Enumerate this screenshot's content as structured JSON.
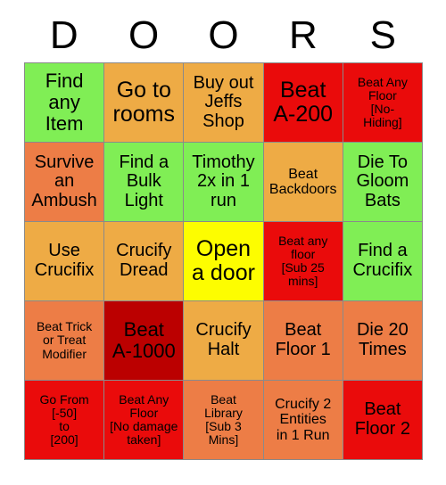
{
  "title": "DOORS Bingo Card",
  "header": {
    "letters": [
      "D",
      "O",
      "O",
      "R",
      "S"
    ]
  },
  "colors": {
    "green": "#80ee55",
    "golden": "#eeab45",
    "coral": "#ed7d46",
    "red": "#ea0b0b",
    "dark_red": "#bb0000",
    "yellow": "#fdfd00",
    "border": "#8a8a8a",
    "text": "#000000",
    "background": "#ffffff"
  },
  "grid": {
    "rows": 5,
    "columns": 5,
    "cells": [
      {
        "text": "Find\nany\nItem",
        "color": "#80ee55",
        "size": "fs-lg"
      },
      {
        "text": "Go to\nrooms",
        "color": "#eeab45",
        "size": "fs-xl"
      },
      {
        "text": "Buy out\nJeffs\nShop",
        "color": "#eeab45",
        "size": "fs-md"
      },
      {
        "text": "Beat\nA-200",
        "color": "#ea0b0b",
        "size": "fs-xl"
      },
      {
        "text": "Beat Any\nFloor\n[No-\nHiding]",
        "color": "#ea0b0b",
        "size": "fs-xs"
      },
      {
        "text": "Survive\nan\nAmbush",
        "color": "#ed7d46",
        "size": "fs-md"
      },
      {
        "text": "Find a\nBulk\nLight",
        "color": "#80ee55",
        "size": "fs-md"
      },
      {
        "text": "Timothy\n2x in 1\nrun",
        "color": "#80ee55",
        "size": "fs-md"
      },
      {
        "text": "Beat\nBackdoors",
        "color": "#eeab45",
        "size": "fs-sm"
      },
      {
        "text": "Die To\nGloom\nBats",
        "color": "#80ee55",
        "size": "fs-md"
      },
      {
        "text": "Use\nCrucifix",
        "color": "#eeab45",
        "size": "fs-md"
      },
      {
        "text": "Crucify\nDread",
        "color": "#eeab45",
        "size": "fs-md"
      },
      {
        "text": "Open\na door",
        "color": "#fdfd00",
        "size": "fs-xl"
      },
      {
        "text": "Beat any\nfloor\n[Sub 25\nmins]",
        "color": "#ea0b0b",
        "size": "fs-xs"
      },
      {
        "text": "Find a\nCrucifix",
        "color": "#80ee55",
        "size": "fs-md"
      },
      {
        "text": "Beat Trick\nor Treat\nModifier",
        "color": "#ed7d46",
        "size": "fs-xs"
      },
      {
        "text": "Beat\nA-1000",
        "color": "#bb0000",
        "size": "fs-lg"
      },
      {
        "text": "Crucify\nHalt",
        "color": "#eeab45",
        "size": "fs-md"
      },
      {
        "text": "Beat\nFloor 1",
        "color": "#ed7d46",
        "size": "fs-md"
      },
      {
        "text": "Die 20\nTimes",
        "color": "#ed7d46",
        "size": "fs-md"
      },
      {
        "text": "Go From\n[-50]\nto\n[200]",
        "color": "#ea0b0b",
        "size": "fs-xs"
      },
      {
        "text": "Beat Any\nFloor\n[No damage\ntaken]",
        "color": "#ea0b0b",
        "size": "fs-xs"
      },
      {
        "text": "Beat\nLibrary\n[Sub 3\nMins]",
        "color": "#ed7d46",
        "size": "fs-xs"
      },
      {
        "text": "Crucify 2\nEntities\nin 1 Run",
        "color": "#ed7d46",
        "size": "fs-sm"
      },
      {
        "text": "Beat\nFloor 2",
        "color": "#ea0b0b",
        "size": "fs-md"
      }
    ]
  }
}
